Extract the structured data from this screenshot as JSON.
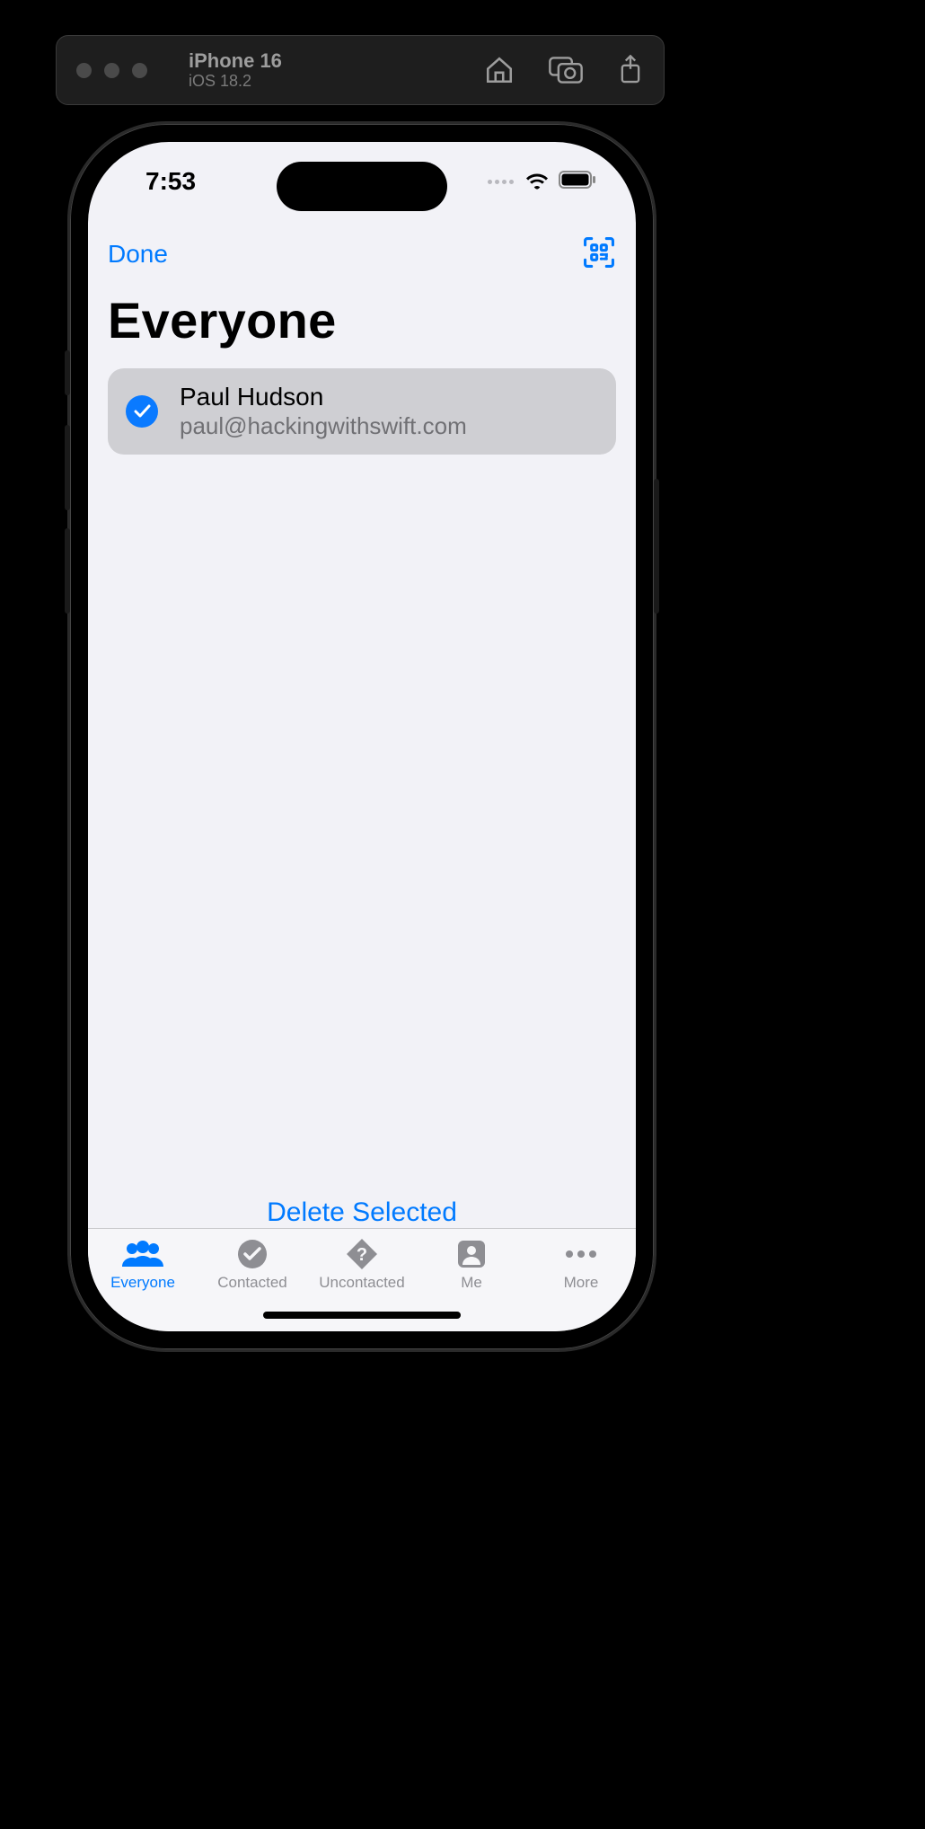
{
  "simulator": {
    "device": "iPhone 16",
    "os": "iOS 18.2",
    "toolbar_icons": [
      "home-icon",
      "screenshot-icon",
      "share-icon"
    ]
  },
  "status": {
    "time": "7:53"
  },
  "nav": {
    "done_label": "Done",
    "large_title": "Everyone"
  },
  "contacts": [
    {
      "name": "Paul Hudson",
      "email": "paul@hackingwithswift.com",
      "selected": true
    }
  ],
  "toolbar": {
    "delete_label": "Delete Selected"
  },
  "tabs": [
    {
      "label": "Everyone",
      "icon": "people-icon",
      "active": true
    },
    {
      "label": "Contacted",
      "icon": "checkmark-icon",
      "active": false
    },
    {
      "label": "Uncontacted",
      "icon": "question-icon",
      "active": false
    },
    {
      "label": "Me",
      "icon": "person-icon",
      "active": false
    },
    {
      "label": "More",
      "icon": "ellipsis-icon",
      "active": false
    }
  ],
  "colors": {
    "accent": "#007aff",
    "inactive": "#8e8e93",
    "bg": "#f2f2f7"
  }
}
